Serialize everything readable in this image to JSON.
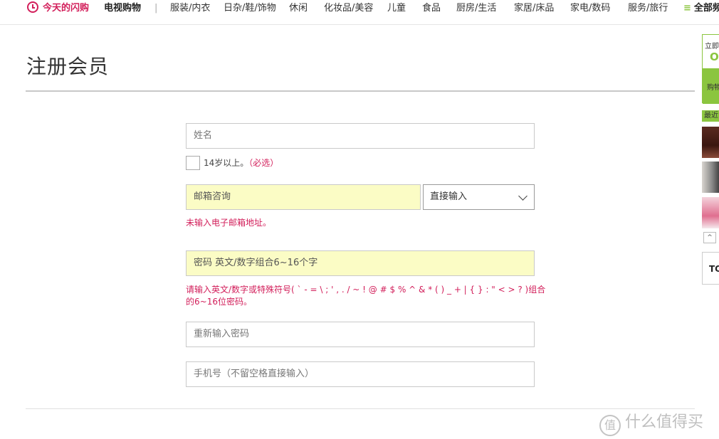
{
  "nav": {
    "flash": "今天的闪购",
    "tv": "电视购物",
    "sep": "|",
    "cats": [
      "服装/内衣",
      "日杂/鞋/饰物",
      "休闲",
      "化妆品/美容",
      "儿童",
      "食品",
      "厨房/生活",
      "家居/床品",
      "家电/数码",
      "服务/旅行"
    ],
    "all": "全部频道",
    "hamburger": "≡"
  },
  "page": {
    "title": "注册会员"
  },
  "form": {
    "name_placeholder": "姓名",
    "age_check_label": "14岁以上。",
    "age_required": "（必选）",
    "email_placeholder": "邮箱咨询",
    "email_domain": "直接输入",
    "email_error": "未输入电子邮箱地址。",
    "password_placeholder": "密码 英文/数字组合6~16个字",
    "password_error_1": "请输入英文/数字或特殊符号( ` - = \\ ; ' , . / ~ ! @ # $ % ^ & * ( ) _ + | { } : \" < > ? )组合",
    "password_error_2": "的6~16位密码。",
    "confirm_placeholder": "重新输入密码",
    "phone_placeholder": "手机号（不留空格直接输入）"
  },
  "side": {
    "card_line1": "立即",
    "card_line2": "OI",
    "card_line3": "购物",
    "recent": "最近",
    "up": "^",
    "top": "TO"
  },
  "watermark": {
    "icon": "值",
    "text": "什么值得买"
  },
  "colors": {
    "accent": "#d21e5a",
    "green": "#8bc53f",
    "highlight": "#fbfcc5"
  }
}
